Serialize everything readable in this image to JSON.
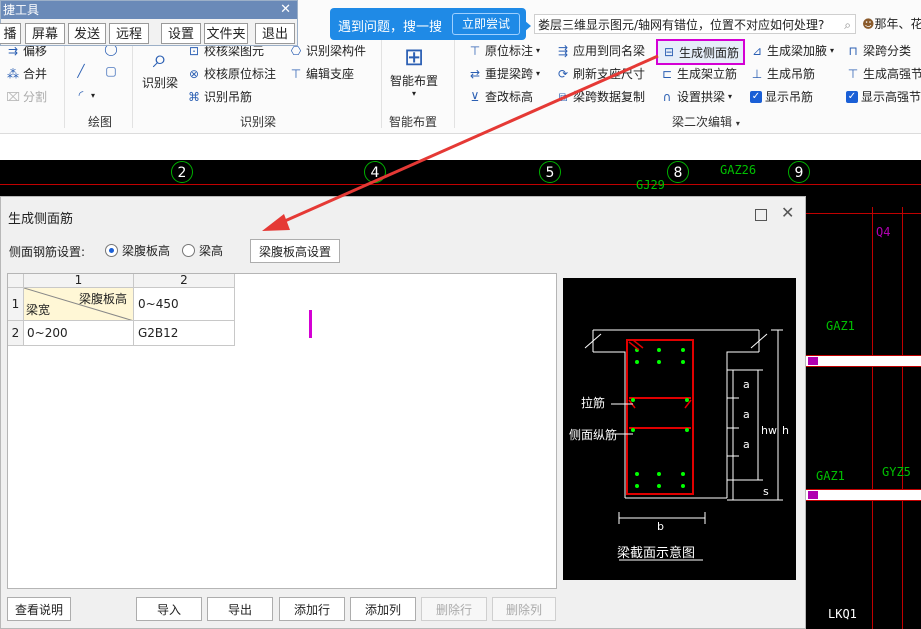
{
  "float_toolbar": {
    "title": "捷工具",
    "buttons": [
      "播",
      "屏幕",
      "发送",
      "远程",
      "设置",
      "文件夹",
      "退出"
    ]
  },
  "tip": {
    "text": "遇到问题，搜一搜",
    "button": "立即尝试"
  },
  "search": {
    "value": "娄层三维显示图元/轴网有错位，位置不对应如何处理?"
  },
  "user": {
    "name": "那年、花"
  },
  "ribbon": {
    "draw_items": [
      "偏移",
      "合并",
      "分割"
    ],
    "recognize_items": [
      "识别梁",
      "校核梁图元",
      "校核原位标注",
      "识别吊筋",
      "识别梁构件",
      "编辑支座"
    ],
    "smart": "智能布置",
    "edit_items": {
      "col1": [
        "原位标注",
        "重提梁跨",
        "查改标高"
      ],
      "col2": [
        "应用到同名梁",
        "刷新支座尺寸",
        "梁跨数据复制"
      ],
      "col3": [
        "生成侧面筋",
        "生成架立筋",
        "设置拱梁"
      ],
      "col4": [
        "生成梁加腋",
        "生成吊筋",
        "显示吊筋"
      ],
      "col5": [
        "梁跨分类",
        "生成高强节",
        "显示高强节"
      ]
    },
    "groups": {
      "draw": "绘图",
      "recognize": "识别梁",
      "smart": "智能布置",
      "edit": "梁二次编辑"
    }
  },
  "cad": {
    "axes": [
      "2",
      "4",
      "5",
      "8",
      "9"
    ],
    "labels": [
      "GJ29",
      "GAZ26",
      "Q4",
      "GAZ1",
      "GAZ1",
      "GYZ5",
      "LKQ1"
    ]
  },
  "dialog": {
    "title": "生成侧面筋",
    "setting_label": "侧面钢筋设置:",
    "radio_web_height": "梁腹板高",
    "radio_beam_height": "梁高",
    "btn_web_setting": "梁腹板高设置",
    "table": {
      "col_numbers": [
        "1",
        "2"
      ],
      "row_numbers": [
        "1",
        "2"
      ],
      "corner_top": "梁腹板高",
      "corner_bottom": "梁宽",
      "r1c2": "0~450",
      "r2c1": "0~200",
      "r2c2": "G2B12"
    },
    "buttons": {
      "help": "查看说明",
      "import": "导入",
      "export": "导出",
      "add_row": "添加行",
      "add_col": "添加列",
      "del_row": "删除行",
      "del_col": "删除列"
    },
    "preview": {
      "tie_label": "拉筋",
      "side_label": "侧面纵筋",
      "caption": "梁截面示意图",
      "dim_a": "a",
      "dim_hw": "hw",
      "dim_h": "h",
      "dim_s": "s",
      "dim_b": "b"
    }
  },
  "colors": {
    "highlight": "#d400d4",
    "arrow": "#e53935",
    "tip_blue": "#1f8ae6",
    "cad_green": "#00c000",
    "rebar_red": "#e00000"
  }
}
